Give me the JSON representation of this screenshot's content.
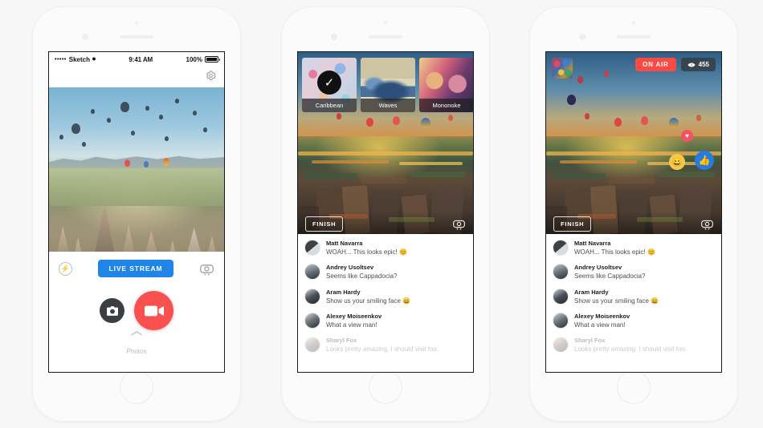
{
  "status_bar": {
    "carrier_dots": "•••••",
    "carrier": "Sketch",
    "wifi_icon": "wifi-icon",
    "time": "9:41 AM",
    "battery_percent": "100%"
  },
  "phone1": {
    "gear_icon": "gear-icon",
    "flash_icon": "flash-icon",
    "live_stream_label": "LIVE STREAM",
    "flip_camera_icon": "flip-camera-icon",
    "photo_button_icon": "camera-icon",
    "video_button_icon": "video-icon",
    "photos_label": "Photos",
    "chevron_up_icon": "chevron-up-icon",
    "accent_blue": "#1f86e8",
    "accent_red": "#f8514f"
  },
  "phone2": {
    "filters": [
      {
        "name": "Caribbean",
        "selected": true,
        "check_icon": "check-icon"
      },
      {
        "name": "Waves",
        "selected": false
      },
      {
        "name": "Mononoke",
        "selected": false
      }
    ],
    "finish_label": "FINISH",
    "flip_camera_icon": "flip-camera-icon"
  },
  "phone3": {
    "mini_filter_thumb": "filter-thumbnail",
    "on_air_label": "ON AIR",
    "on_air_color": "#fa4a43",
    "viewer_icon": "eye-icon",
    "viewer_count": "455",
    "finish_label": "FINISH",
    "flip_camera_icon": "flip-camera-icon",
    "reactions": [
      {
        "name": "heart-reaction",
        "glyph": "♥",
        "color": "#f25268"
      },
      {
        "name": "laugh-reaction",
        "glyph": "😄",
        "color": "#f7c948"
      },
      {
        "name": "like-reaction",
        "glyph": "👍",
        "color": "#2a7cdc"
      }
    ]
  },
  "comments": [
    {
      "name": "Matt Navarra",
      "text": "WOAH... This looks epic! 😊",
      "faded": false
    },
    {
      "name": "Andrey Usoltsev",
      "text": "Seems like Cappadocia?",
      "faded": false
    },
    {
      "name": "Aram Hardy",
      "text": "Show us your smiling face 😄",
      "faded": false
    },
    {
      "name": "Alexey Moiseenkov",
      "text": "What a view man!",
      "faded": false
    },
    {
      "name": "Sharyl Fox",
      "text": "Looks pretty amazing. I should visit too.",
      "faded": true
    }
  ]
}
